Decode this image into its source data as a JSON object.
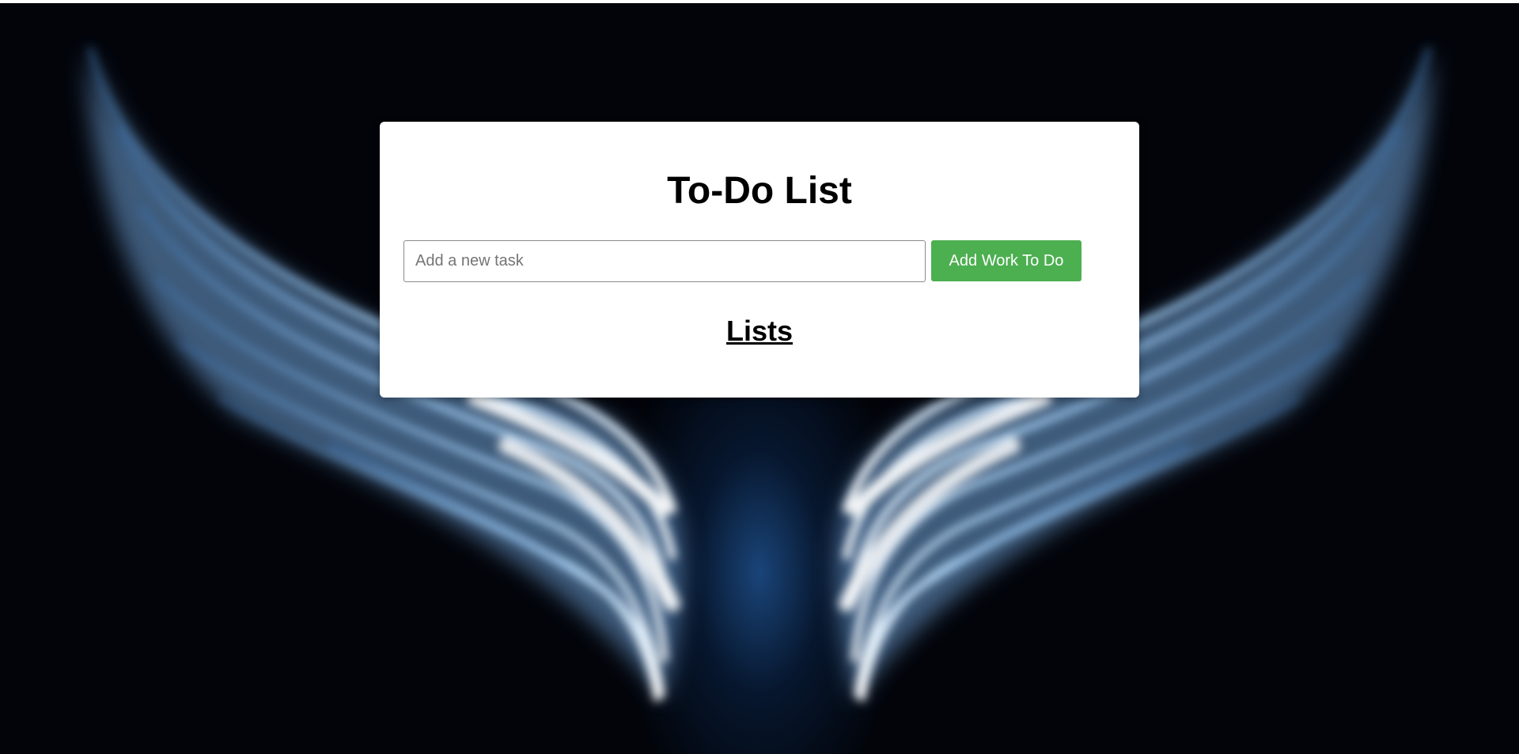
{
  "app": {
    "title": "To-Do List"
  },
  "task_input": {
    "placeholder": "Add a new task",
    "value": ""
  },
  "add_button": {
    "label": "Add Work To Do"
  },
  "lists": {
    "heading": "Lists",
    "items": []
  },
  "colors": {
    "card_background": "#ffffff",
    "button_background": "#4caf50",
    "button_text": "#ffffff",
    "page_background": "#02040a",
    "wing_glow": "#bfe0ff"
  },
  "background": {
    "image": "glowing-angel-wings"
  }
}
